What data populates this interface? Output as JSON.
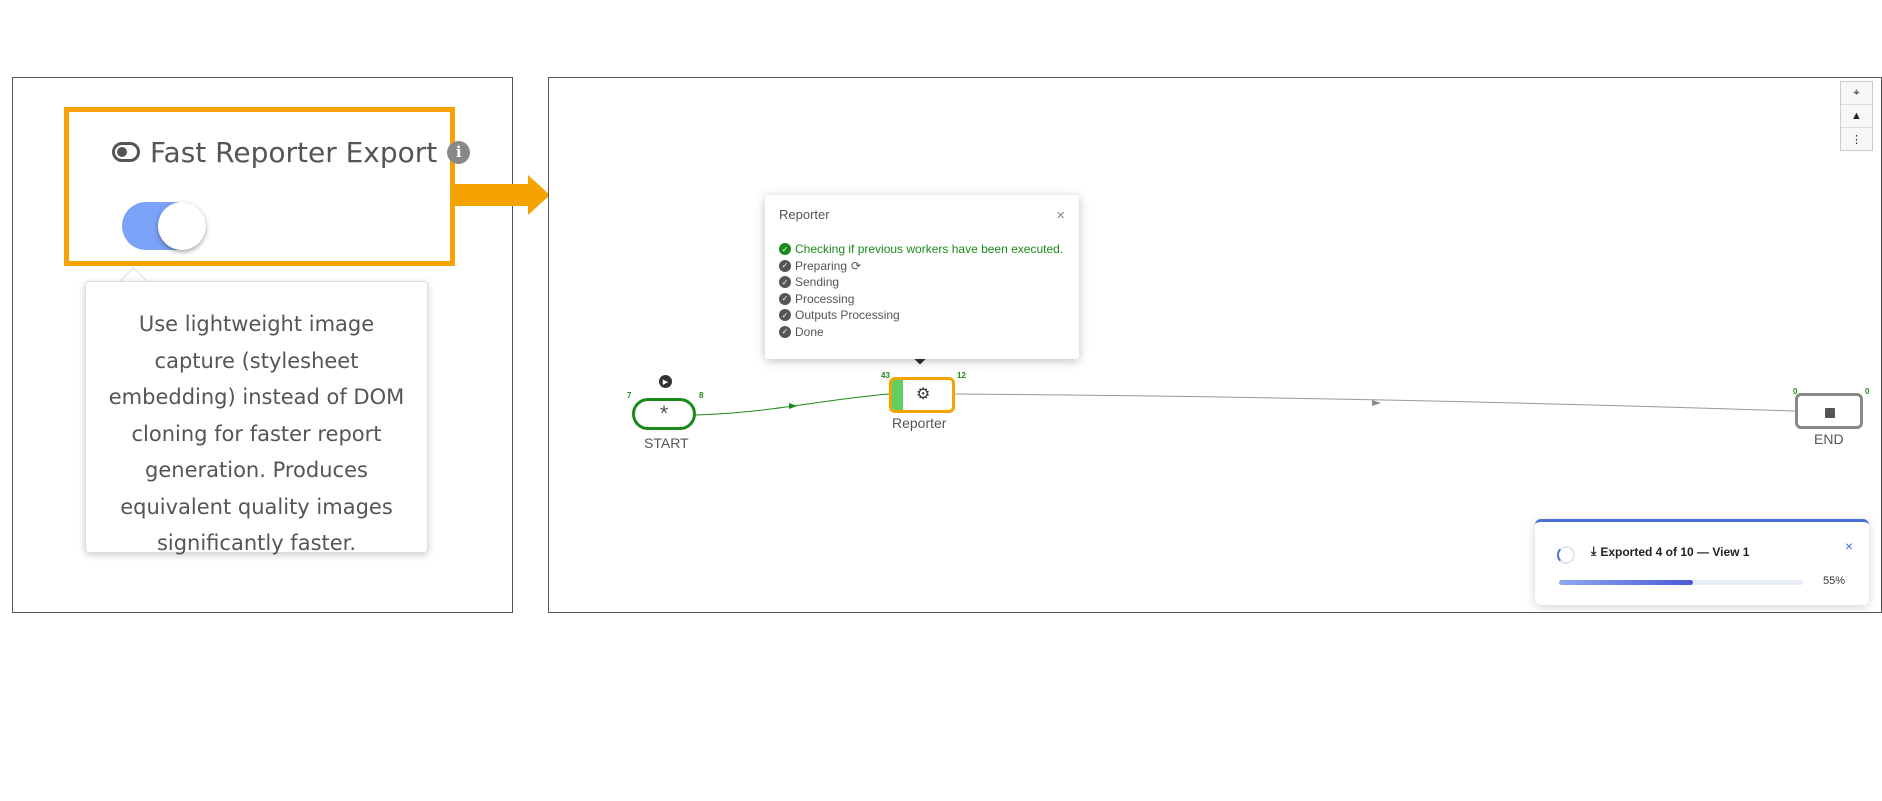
{
  "setting": {
    "title": "Fast Reporter Export",
    "info_icon": "i",
    "toggle_on": true,
    "tooltip": "Use lightweight image capture (stylesheet embedding) instead of DOM cloning for faster report generation. Produces equivalent quality images significantly faster."
  },
  "colors": {
    "highlight": "#f5a300",
    "toggle": "#7aa3f7",
    "success": "#1a8a1a",
    "accent": "#4a6fd8"
  },
  "toolbar": {
    "icons": [
      "crosshair-icon",
      "warning-icon",
      "more-vertical-icon"
    ]
  },
  "popover": {
    "title": "Reporter",
    "close": "×",
    "statuses": [
      {
        "label": "Checking if previous workers have been executed.",
        "active": true
      },
      {
        "label": "Preparing",
        "active": false
      },
      {
        "label": "Sending",
        "active": false
      },
      {
        "label": "Processing",
        "active": false
      },
      {
        "label": "Outputs Processing",
        "active": false
      },
      {
        "label": "Done",
        "active": false
      }
    ]
  },
  "nodes": {
    "start": {
      "label": "START",
      "symbol": "*",
      "in_count": "7",
      "out_count": "8"
    },
    "reporter": {
      "label": "Reporter",
      "in_count": "43",
      "out_count": "12",
      "progress": 0.2
    },
    "end": {
      "label": "END",
      "in_count": "0",
      "out_count": "0"
    }
  },
  "export_toast": {
    "title": "Exported 4 of 10 — View 1",
    "close": "×",
    "progress": 55,
    "progress_label": "55%"
  }
}
